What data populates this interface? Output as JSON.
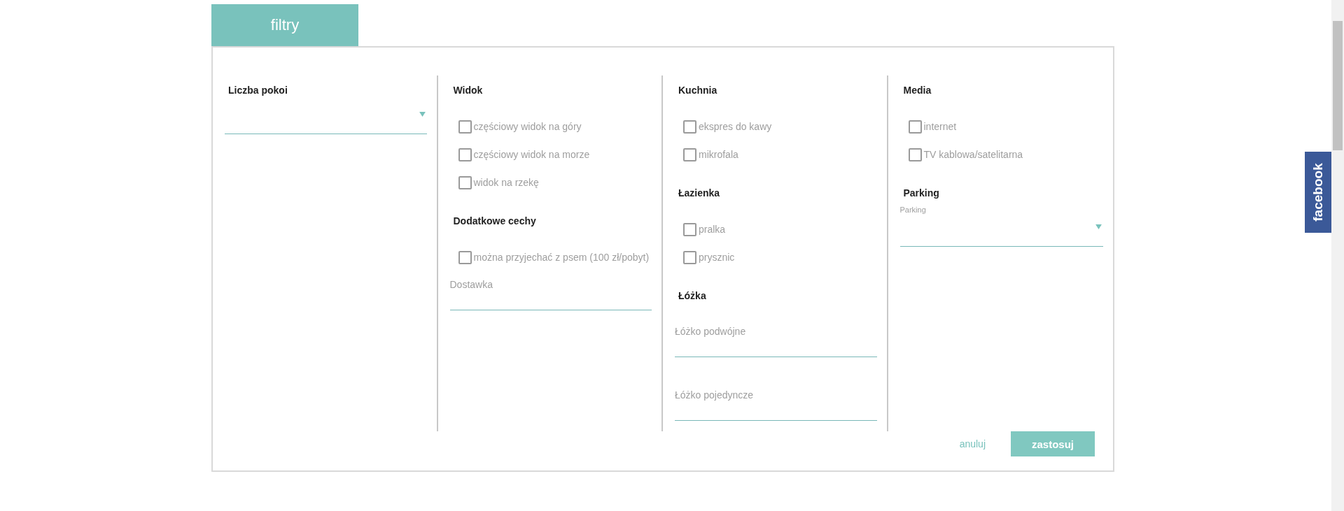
{
  "tab": {
    "label": "filtry",
    "selected": true
  },
  "columns": [
    {
      "sections": [
        {
          "title": "Liczba pokoi",
          "controls": [
            {
              "kind": "select"
            }
          ]
        }
      ]
    },
    {
      "sections": [
        {
          "title": "Widok",
          "controls": [
            {
              "kind": "checkbox",
              "label": "częściowy widok na góry",
              "checked": false
            },
            {
              "kind": "checkbox",
              "label": "częściowy widok na morze",
              "checked": false
            },
            {
              "kind": "checkbox",
              "label": "widok na rzekę",
              "checked": false
            }
          ]
        },
        {
          "title": "Dodatkowe cechy",
          "controls": [
            {
              "kind": "checkbox",
              "label": "można przyjechać z psem (100 zł/pobyt)",
              "checked": false
            },
            {
              "kind": "field",
              "placeholder": "Dostawka"
            }
          ]
        }
      ]
    },
    {
      "sections": [
        {
          "title": "Kuchnia",
          "controls": [
            {
              "kind": "checkbox",
              "label": "ekspres do kawy",
              "checked": false
            },
            {
              "kind": "checkbox",
              "label": "mikrofala",
              "checked": false
            }
          ]
        },
        {
          "title": "Łazienka",
          "controls": [
            {
              "kind": "checkbox",
              "label": "pralka",
              "checked": false
            },
            {
              "kind": "checkbox",
              "label": "prysznic",
              "checked": false
            }
          ]
        },
        {
          "title": "Łóżka",
          "controls": [
            {
              "kind": "field",
              "placeholder": "Łóżko podwójne"
            },
            {
              "kind": "field",
              "placeholder": "Łóżko pojedyncze"
            }
          ]
        }
      ]
    },
    {
      "sections": [
        {
          "title": "Media",
          "controls": [
            {
              "kind": "checkbox",
              "label": "internet",
              "checked": false
            },
            {
              "kind": "checkbox",
              "label": "TV kablowa/satelitarna",
              "checked": false
            }
          ]
        },
        {
          "title": "Parking",
          "controls": [
            {
              "kind": "select",
              "label": "Parking"
            }
          ]
        }
      ]
    }
  ],
  "actions": {
    "cancel": "anuluj",
    "apply": "zastosuj"
  },
  "social_tab": {
    "label": "facebook"
  }
}
